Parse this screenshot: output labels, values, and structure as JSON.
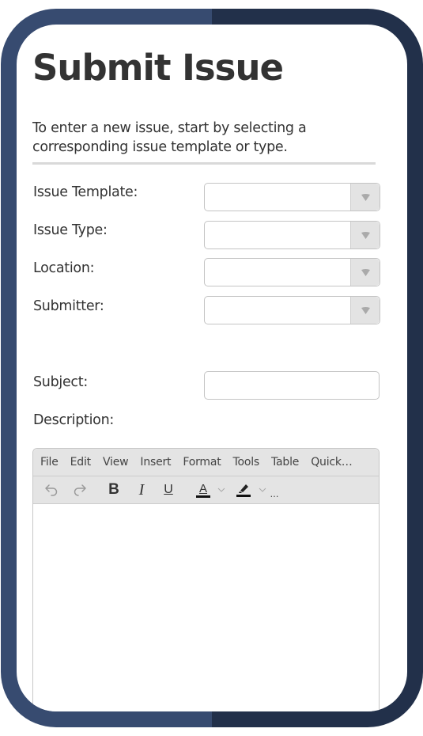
{
  "page": {
    "title": "Submit Issue",
    "intro": "To enter a new issue, start by selecting a corresponding issue template or type."
  },
  "form": {
    "fields": [
      {
        "label": "Issue Template:",
        "type": "select",
        "value": ""
      },
      {
        "label": "Issue Type:",
        "type": "select",
        "value": ""
      },
      {
        "label": "Location:",
        "type": "select",
        "value": ""
      },
      {
        "label": "Submitter:",
        "type": "select",
        "value": ""
      }
    ],
    "subject": {
      "label": "Subject:",
      "value": "",
      "placeholder": ""
    },
    "description": {
      "label": "Description:",
      "value": ""
    }
  },
  "editor": {
    "menu": [
      "File",
      "Edit",
      "View",
      "Insert",
      "Format",
      "Tools",
      "Table",
      "Quick…"
    ],
    "toolbar": {
      "undo": "undo-icon",
      "redo": "redo-icon",
      "bold": "B",
      "italic": "I",
      "underline": "U",
      "text_color": "A",
      "highlight": "highlighter-icon",
      "more": "…"
    }
  },
  "colors": {
    "frame_left": "#374b70",
    "frame_right": "#22304a",
    "text": "#333333"
  }
}
